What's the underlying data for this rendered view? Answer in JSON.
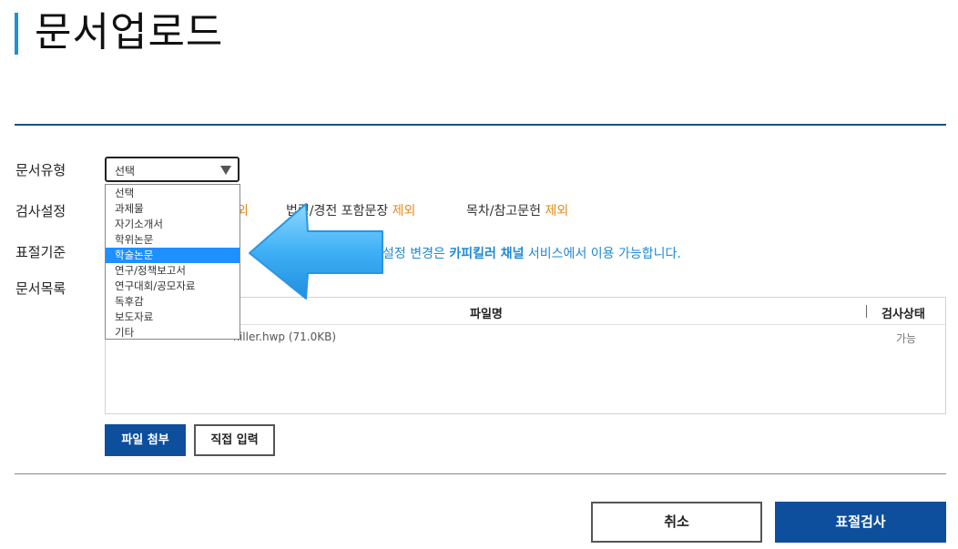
{
  "page": {
    "title": "문서업로드"
  },
  "form": {
    "doc_type_label": "문서유형",
    "check_setting_label": "검사설정",
    "plag_criteria_label": "표절기준",
    "doc_list_label": "문서목록",
    "doc_type_select_value": "선택",
    "check_options": [
      {
        "text": "법령/경전 포함문장",
        "suffix": "제외"
      },
      {
        "text": "목차/참고문헌",
        "suffix": "제외"
      }
    ],
    "partial_exclude_suffix": "외",
    "criteria_info_prefix": "설정 변경은 ",
    "criteria_info_channel": "카피킬러 채널",
    "criteria_info_suffix": " 서비스에서 이용 가능합니다."
  },
  "dropdown": {
    "options": [
      "선택",
      "과제물",
      "자기소개서",
      "학위논문",
      "학술논문",
      "연구/정책보고서",
      "연구대회/공모자료",
      "독후감",
      "보도자료",
      "기타"
    ],
    "selected_index": 4
  },
  "file_table": {
    "col_filename": "파일명",
    "col_status": "검사상태",
    "rows": [
      {
        "filename": "killer.hwp (71.0KB)",
        "status": "가능"
      }
    ]
  },
  "buttons": {
    "attach_file": "파일 첨부",
    "direct_input": "직접 입력",
    "cancel": "취소",
    "plag_check": "표절검사"
  },
  "colors": {
    "accent_blue": "#0d4f9c",
    "title_bar": "#1e90d6",
    "exclude_orange": "#e48a1e",
    "info_blue": "#1e8ad6"
  }
}
